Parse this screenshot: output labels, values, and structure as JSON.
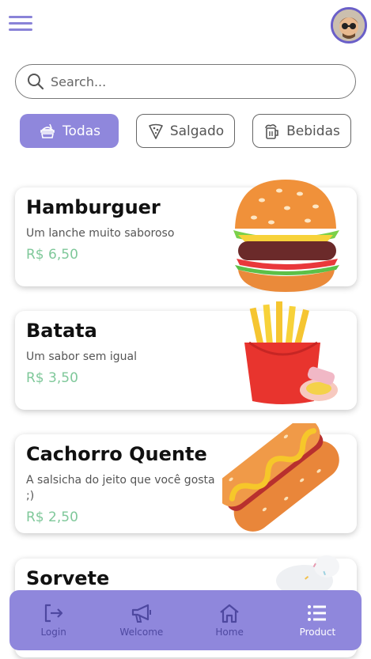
{
  "search": {
    "placeholder": "Search..."
  },
  "filters": [
    {
      "label": "Todas",
      "active": true
    },
    {
      "label": "Salgado",
      "active": false
    },
    {
      "label": "Bebidas",
      "active": false
    }
  ],
  "products": [
    {
      "name": "Hamburguer",
      "description": "Um lanche muito saboroso",
      "price": "R$ 6,50",
      "icon": "burger-image"
    },
    {
      "name": "Batata",
      "description": "Um sabor sem igual",
      "price": "R$ 3,50",
      "icon": "fries-image"
    },
    {
      "name": "Cachorro Quente",
      "description": "A salsicha do jeito que você gosta ;)",
      "price": "R$ 2,50",
      "icon": "hotdog-image"
    },
    {
      "name": "Sorvete",
      "description": "",
      "price": "",
      "icon": "icecream-image"
    }
  ],
  "nav": [
    {
      "label": "Login",
      "icon": "login-icon"
    },
    {
      "label": "Welcome",
      "icon": "megaphone-icon"
    },
    {
      "label": "Home",
      "icon": "home-icon"
    },
    {
      "label": "Product",
      "icon": "list-icon",
      "active": true
    }
  ],
  "colors": {
    "accent": "#8f87dc",
    "price": "#7fc89a"
  }
}
